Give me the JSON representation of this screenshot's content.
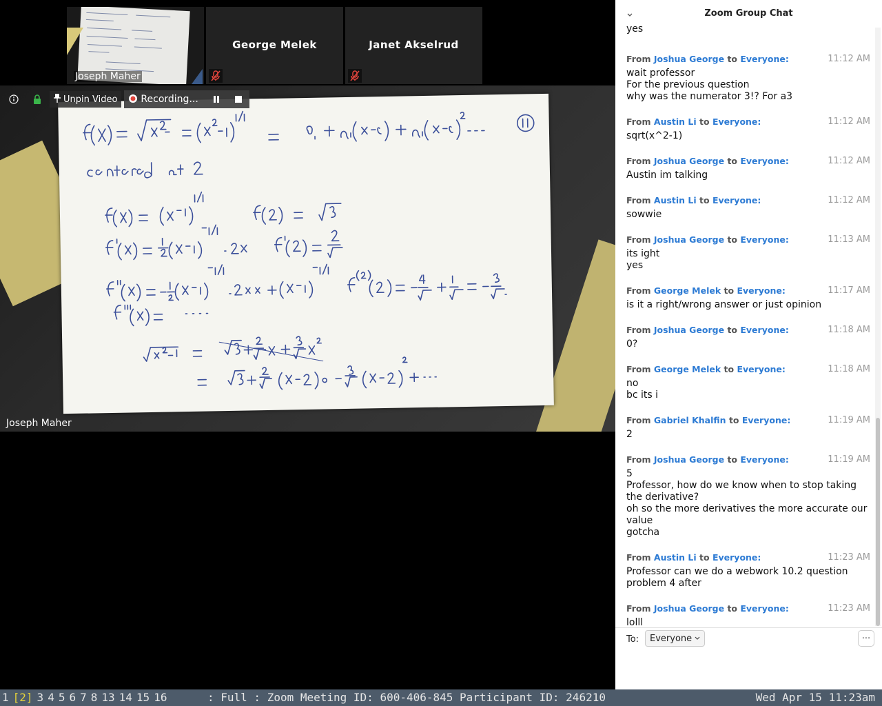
{
  "participants": {
    "thumb1_name": "Joseph Maher",
    "thumb2_name": "George Melek",
    "thumb3_name": "Janet Akselrud"
  },
  "toolbar": {
    "unpin_label": "Unpin Video",
    "recording_label": "Recording..."
  },
  "speaker": {
    "name": "Joseph Maher"
  },
  "chat": {
    "title": "Zoom Group Chat",
    "from_word": "From",
    "to_word": "to",
    "first_line": "yes",
    "messages": [
      {
        "from": "Joshua George",
        "to": "Everyone:",
        "time": "11:12 AM",
        "lines": [
          "wait professor",
          "For the previous question",
          "why was the numerator 3!? For a3"
        ]
      },
      {
        "from": "Austin Li",
        "to": "Everyone:",
        "time": "11:12 AM",
        "lines": [
          "sqrt(x^2-1)"
        ]
      },
      {
        "from": "Joshua George",
        "to": "Everyone:",
        "time": "11:12 AM",
        "lines": [
          "Austin im talking"
        ]
      },
      {
        "from": "Austin Li",
        "to": "Everyone:",
        "time": "11:12 AM",
        "lines": [
          "sowwie"
        ]
      },
      {
        "from": "Joshua George",
        "to": "Everyone:",
        "time": "11:13 AM",
        "lines": [
          "its ight",
          "yes"
        ]
      },
      {
        "from": "George Melek",
        "to": "Everyone:",
        "time": "11:17 AM",
        "lines": [
          "is it a right/wrong answer or just opinion"
        ]
      },
      {
        "from": "Joshua George",
        "to": "Everyone:",
        "time": "11:18 AM",
        "lines": [
          "0?"
        ]
      },
      {
        "from": "George Melek",
        "to": "Everyone:",
        "time": "11:18 AM",
        "lines": [
          "no",
          "bc its i"
        ]
      },
      {
        "from": "Gabriel Khalfin",
        "to": "Everyone:",
        "time": "11:19 AM",
        "lines": [
          "2"
        ]
      },
      {
        "from": "Joshua George",
        "to": "Everyone:",
        "time": "11:19 AM",
        "lines": [
          "5",
          "Professor, how do we know when to stop taking",
          "the derivative?",
          "oh so the more derivatives the more accurate our",
          "value",
          "gotcha"
        ]
      },
      {
        "from": "Austin Li",
        "to": "Everyone:",
        "time": "11:23 AM",
        "lines": [
          "Professor can we do a webwork 10.2 question",
          "problem 4 after"
        ]
      },
      {
        "from": "Joshua George",
        "to": "Everyone:",
        "time": "11:23 AM",
        "lines": [
          "lolll"
        ]
      }
    ],
    "to_label": "To:",
    "to_value": "Everyone",
    "more_label": "···"
  },
  "statusbar": {
    "workspaces": [
      "1",
      "[2]",
      "3",
      "4",
      "5",
      "6",
      "7",
      "8",
      "13",
      "14",
      "15",
      "16"
    ],
    "active_index": 1,
    "status_text": ": Full : Zoom Meeting ID: 600-406-845 Participant ID: 246210",
    "clock": "Wed Apr 15 11:23am"
  },
  "colors": {
    "chat_name": "#2d7bd4",
    "statusbar_bg": "#4d5b6a",
    "active_workspace": "#e5d23b",
    "recording_dot": "#e0443c"
  }
}
